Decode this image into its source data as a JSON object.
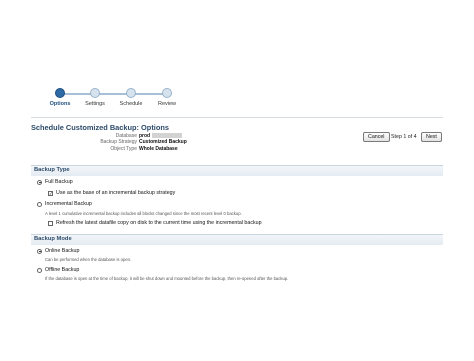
{
  "train": {
    "steps": [
      "Options",
      "Settings",
      "Schedule",
      "Review"
    ],
    "active_index": 0
  },
  "page": {
    "title": "Schedule Customized Backup: Options",
    "database_label": "Database",
    "database_value": "prod",
    "strategy_label": "Backup Strategy",
    "strategy_value": "Customized Backup",
    "object_type_label": "Object Type",
    "object_type_value": "Whole Database"
  },
  "nav": {
    "cancel_label": "Cancel",
    "step_text": "Step 1 of 4",
    "next_label": "Next"
  },
  "backup_type": {
    "title": "Backup Type",
    "full_label": "Full Backup",
    "full_selected": true,
    "full_checkbox_label": "Use as the base of an incremental backup strategy",
    "full_checkbox_checked": true,
    "incremental_label": "Incremental Backup",
    "incremental_selected": false,
    "incremental_desc": "A level 1 cumulative incremental backup includes all blocks changed since the most recent level 0 backup.",
    "refresh_checkbox_label": "Refresh the latest datafile copy on disk to the current time using the incremental backup",
    "refresh_checkbox_checked": false
  },
  "backup_mode": {
    "title": "Backup Mode",
    "online_label": "Online Backup",
    "online_selected": true,
    "online_desc": "Can be performed when the database is open.",
    "offline_label": "Offline Backup",
    "offline_selected": false,
    "offline_desc": "If the database is open at the time of backup, it will be shut down and mounted before the backup, then re-opened after the backup."
  },
  "colors": {
    "accent": "#2e6aa5",
    "heading": "#2d4b6b"
  }
}
